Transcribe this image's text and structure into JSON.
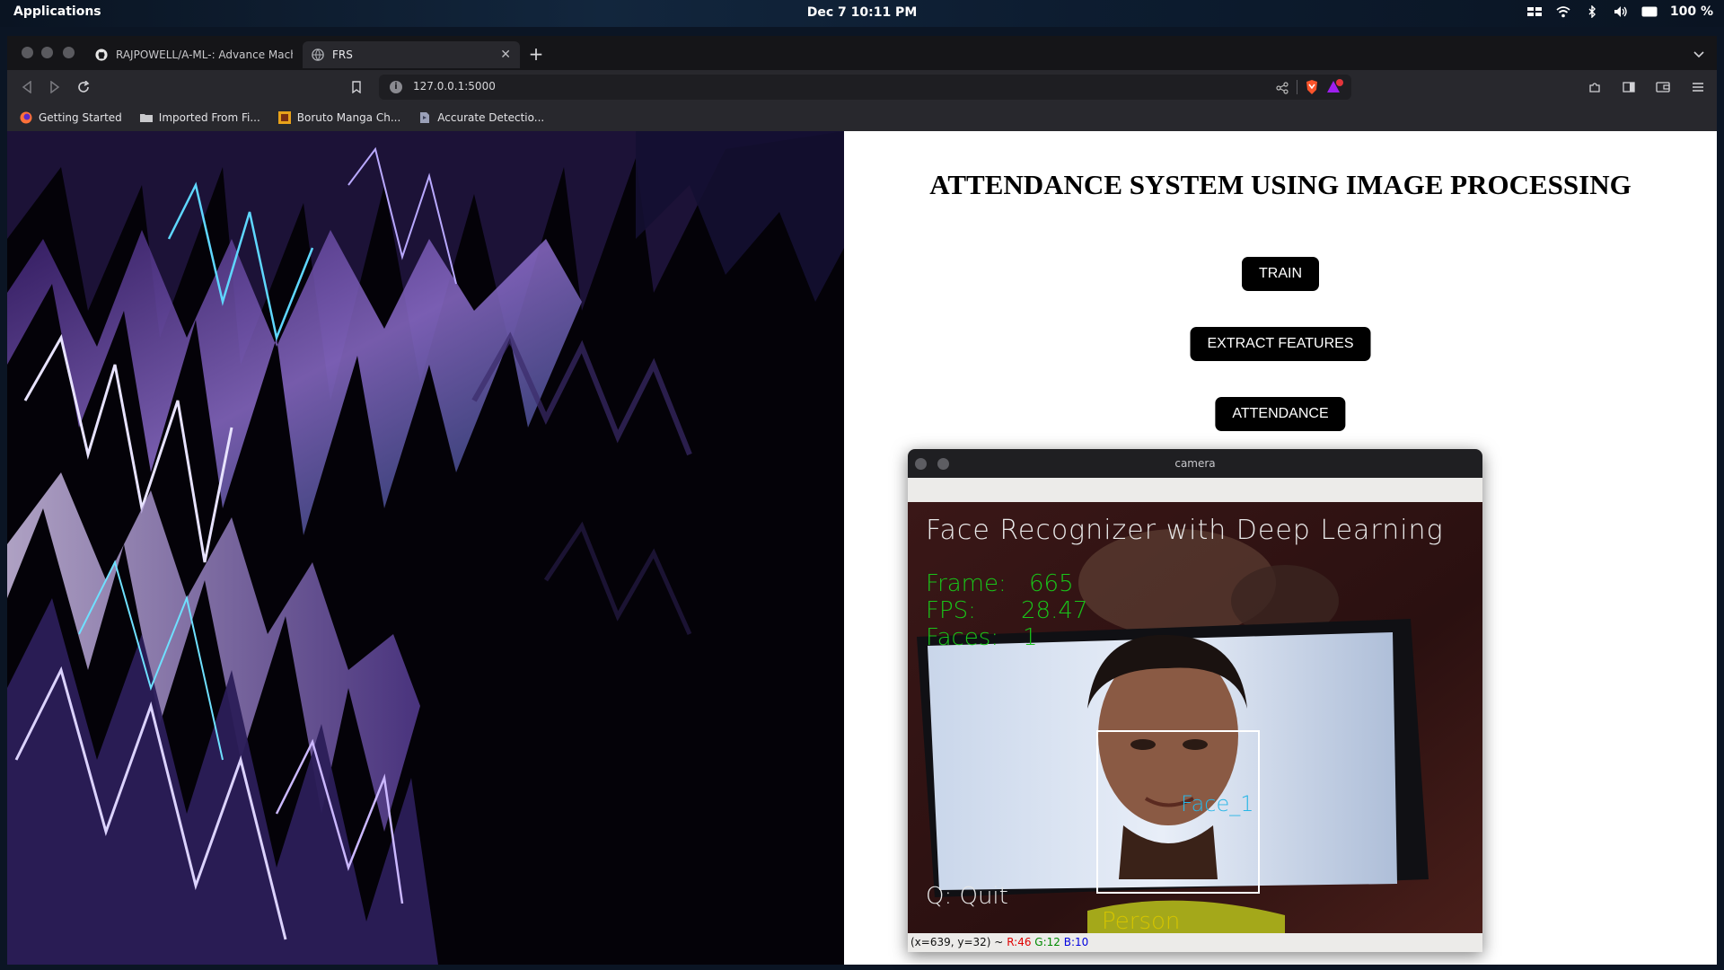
{
  "topbar": {
    "apps_label": "Applications",
    "clock": "Dec 7  10:11 PM",
    "battery": "100 %"
  },
  "tabs": [
    {
      "title": "RAJPOWELL/A-ML-: Advance Machi",
      "icon": "github-icon",
      "active": false
    },
    {
      "title": "FRS",
      "icon": "globe-icon",
      "active": true
    }
  ],
  "toolbar": {
    "url": "127.0.0.1:5000"
  },
  "bookmarks": [
    {
      "label": "Getting Started",
      "icon": "firefox-icon"
    },
    {
      "label": "Imported From Fi...",
      "icon": "folder-icon"
    },
    {
      "label": "Boruto Manga Ch...",
      "icon": "manga-site-icon"
    },
    {
      "label": "Accurate Detectio...",
      "icon": "page-icon"
    }
  ],
  "page": {
    "heading": "ATTENDANCE SYSTEM USING IMAGE PROCESSING",
    "buttons": {
      "train": "TRAIN",
      "extract": "EXTRACT FEATURES",
      "attendance": "ATTENDANCE"
    }
  },
  "camera": {
    "window_title": "camera",
    "overlay_title": "Face Recognizer with Deep Learning",
    "frame_label": "Frame:",
    "frame_value": "665",
    "fps_label": "FPS:",
    "fps_value": "28.47",
    "faces_label": "Faces:",
    "faces_value": "1",
    "face_tag": "Face_1",
    "person_label": "Person",
    "quit_hint": "Q: Quit",
    "status_coords": "(x=639, y=32) ~",
    "status_r": "R:46",
    "status_g": "G:12",
    "status_b": "B:10"
  },
  "colors": {
    "overlay_white": "#e8e8e8",
    "overlay_green": "#19c419",
    "face_tag_cyan": "#29b6e6",
    "person_yellow": "#d4c400",
    "button_bg": "#000000"
  }
}
